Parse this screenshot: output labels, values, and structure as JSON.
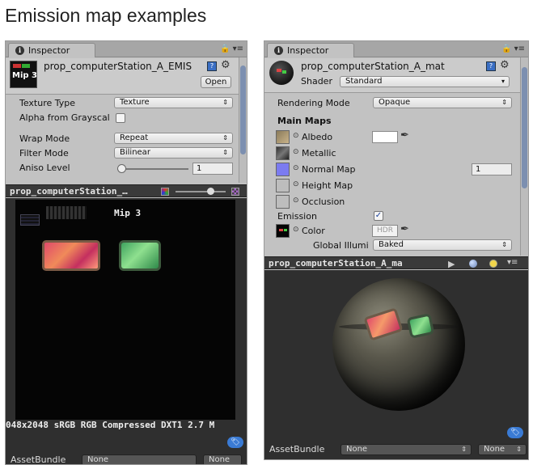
{
  "page_title": "Emission map examples",
  "left": {
    "tab_label": "Inspector",
    "asset_name": "prop_computerStation_A_EMIS",
    "thumb_label": "Mip 3",
    "open_button": "Open",
    "fields": {
      "texture_type_label": "Texture Type",
      "texture_type_value": "Texture",
      "alpha_label": "Alpha from Grayscal",
      "wrap_label": "Wrap Mode",
      "wrap_value": "Repeat",
      "filter_label": "Filter Mode",
      "filter_value": "Bilinear",
      "aniso_label": "Aniso Level",
      "aniso_value": "1"
    },
    "preview_title": "prop_computerStation_…",
    "preview_mip": "Mip 3",
    "preview_info": "048x2048 sRGB  RGB Compressed DXT1   2.7 M",
    "assetbundle_label": "AssetBundle",
    "assetbundle_value": "None",
    "assetbundle_variant": "None"
  },
  "right": {
    "tab_label": "Inspector",
    "asset_name": "prop_computerStation_A_mat",
    "shader_label": "Shader",
    "shader_value": "Standard",
    "rendering_mode_label": "Rendering Mode",
    "rendering_mode_value": "Opaque",
    "main_maps_label": "Main Maps",
    "albedo_label": "Albedo",
    "metallic_label": "Metallic",
    "normal_label": "Normal Map",
    "normal_value": "1",
    "height_label": "Height Map",
    "occlusion_label": "Occlusion",
    "emission_label": "Emission",
    "color_label": "Color",
    "hdr_label": "HDR",
    "gi_label": "Global Illumi",
    "gi_value": "Baked",
    "preview_title": "prop_computerStation_A_ma",
    "assetbundle_label": "AssetBundle",
    "assetbundle_value": "None",
    "assetbundle_variant": "None"
  },
  "colors": {
    "panel_bg": "#c2c2c2",
    "preview_bg": "#2f2f2f",
    "accent_blue": "#3a7bd5",
    "normal_map_swatch": "#7b7bf0"
  }
}
